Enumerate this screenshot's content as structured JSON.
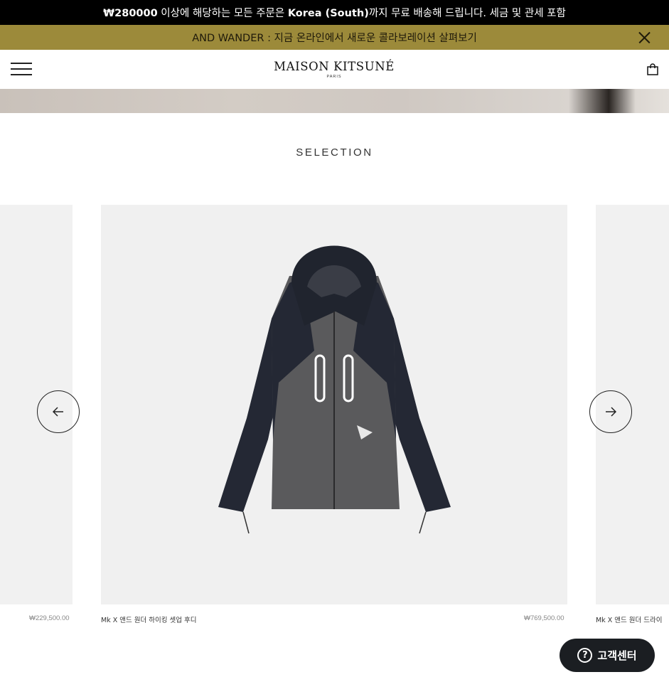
{
  "promo_bar": {
    "amount": "₩280000",
    "text_1": " 이상에 해당하는 모든 주문은 ",
    "country": "Korea (South)",
    "text_2": "까지 무료 배송해 드립니다. 세금 및 관세 포함"
  },
  "collab_bar": {
    "text": "AND WANDER : 지금 온라인에서 새로운 콜라보레이션 살펴보기",
    "close_icon": "close-icon"
  },
  "header": {
    "logo_main": "MAISON KITSUNÉ",
    "logo_sub": "PARIS",
    "menu_icon": "hamburger-menu-icon",
    "cart_icon": "shopping-bag-icon"
  },
  "section": {
    "title": "SELECTION"
  },
  "carousel": {
    "prev_icon": "arrow-left-icon",
    "next_icon": "arrow-right-icon",
    "products": [
      {
        "name": "",
        "price": "₩229,500.00"
      },
      {
        "name": "Mk X 앤드 원더 하이킹 셋업 후디",
        "price": "₩769,500.00"
      },
      {
        "name": "Mk X 앤드 원더 드라이",
        "price": ""
      }
    ]
  },
  "help_button": {
    "label": "고객센터",
    "icon": "question-icon",
    "icon_glyph": "?"
  },
  "colors": {
    "promo_bg": "#000000",
    "collab_bg": "#9c8a3a",
    "help_bg": "#1b1e22"
  }
}
